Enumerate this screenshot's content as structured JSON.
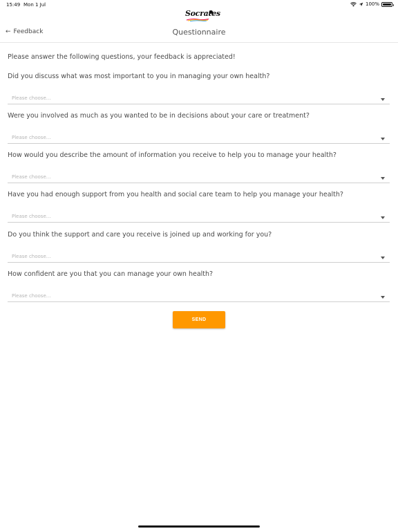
{
  "status_bar": {
    "time": "15:49",
    "date": "Mon 1 Jul",
    "battery": "100%",
    "icons": [
      "wifi-icon",
      "location-arrow-icon",
      "battery-icon"
    ]
  },
  "logo": {
    "text": "Socrates"
  },
  "nav": {
    "back_label": "Feedback",
    "title": "Questionnaire"
  },
  "form": {
    "intro": "Please answer the following questions, your feedback is appreciated!",
    "questions": [
      {
        "text": "Did you discuss what was most important to you in managing your own health?",
        "placeholder": "Please choose..."
      },
      {
        "text": "Were you involved as much as you wanted to be in decisions about your care or treatment?",
        "placeholder": "Please choose..."
      },
      {
        "text": "How would you describe the amount of information you receive to help you to manage your health?",
        "placeholder": "Please choose..."
      },
      {
        "text": "Have you had enough support from you health and social care team to help you manage your health?",
        "placeholder": "Please choose..."
      },
      {
        "text": "Do you think the support and care you receive is joined up and working for you?",
        "placeholder": "Please choose..."
      },
      {
        "text": "How confident are you that you can manage your own health?",
        "placeholder": "Please choose..."
      }
    ],
    "submit_label": "SEND"
  },
  "colors": {
    "accent": "#ff9800",
    "text": "#4a4a4a",
    "placeholder": "#b5b5b5",
    "divider": "#cfcfcf"
  }
}
